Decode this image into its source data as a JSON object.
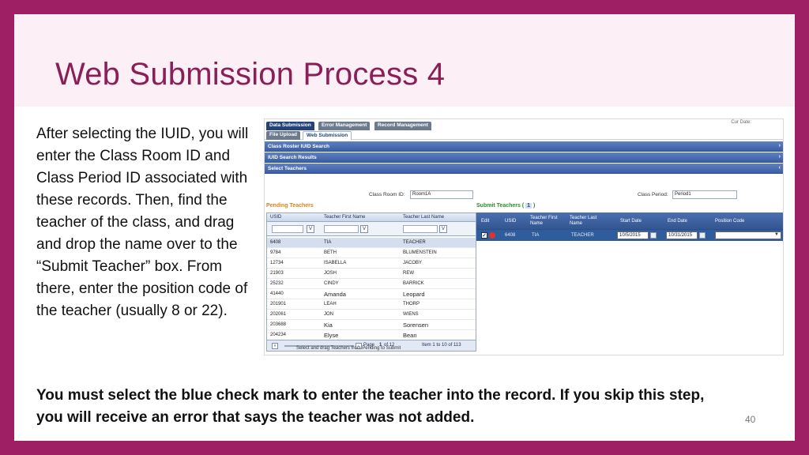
{
  "slide": {
    "title": "Web Submission Process 4",
    "body": "After selecting the IUID, you will enter the Class Room ID and Class Period ID associated with these records. Then, find the teacher of the class, and drag and drop the name over to the “Submit Teacher” box. From there, enter the position code of the teacher (usually 8 or 22).",
    "note": "You must select the blue check mark to enter the teacher into the record. If you skip this step, you will receive an error that says the teacher was not added.",
    "page_number": "40"
  },
  "app": {
    "tabs": [
      "Data Submission",
      "Error Management",
      "Record Management"
    ],
    "subtabs": [
      "File Upload",
      "Web Submission"
    ],
    "top_right": "Cur Date:",
    "sections": [
      "Class Roster IUID Search",
      "IUID Search Results",
      "Select Teachers"
    ],
    "class_room_label": "Class Room ID:",
    "class_room_value": "Room1A",
    "class_period_label": "Class Period:",
    "class_period_value": "Period1",
    "pending": {
      "title": "Pending Teachers",
      "headers": [
        "USID",
        "Teacher First Name",
        "Teacher Last Name"
      ],
      "filter_button": "V",
      "rows": [
        [
          "6408",
          "TIA",
          "TEACHER"
        ],
        [
          "9784",
          "BETH",
          "BLUMENSTEIN"
        ],
        [
          "12734",
          "ISABELLA",
          "JACOBY"
        ],
        [
          "21903",
          "JOSH",
          "REW"
        ],
        [
          "25232",
          "CINDY",
          "BARRICK"
        ],
        [
          "41440",
          "Amanda",
          "Leopard"
        ],
        [
          "201901",
          "LEAH",
          "THORP"
        ],
        [
          "202061",
          "JON",
          "WIENS"
        ],
        [
          "203688",
          "Kia",
          "Sorensen"
        ],
        [
          "204234",
          "Elyse",
          "Bean"
        ]
      ],
      "page_label": "Page",
      "page_current": "1",
      "page_of": "of 12",
      "item_range": "Item 1 to 10 of 113"
    },
    "submit": {
      "title": "Submit Teachers",
      "count": "1",
      "headers": [
        "Edit",
        "USID",
        "Teacher First Name",
        "Teacher Last Name",
        "Start Date",
        "End Date",
        "Position Code"
      ],
      "row": {
        "usid": "6408",
        "first": "TIA",
        "last": "TEACHER",
        "start_date": "10/5/2015",
        "end_date": "10/31/2015",
        "position_code": ""
      }
    },
    "footer": "Select and drag Teachers from Pending to Submit"
  }
}
